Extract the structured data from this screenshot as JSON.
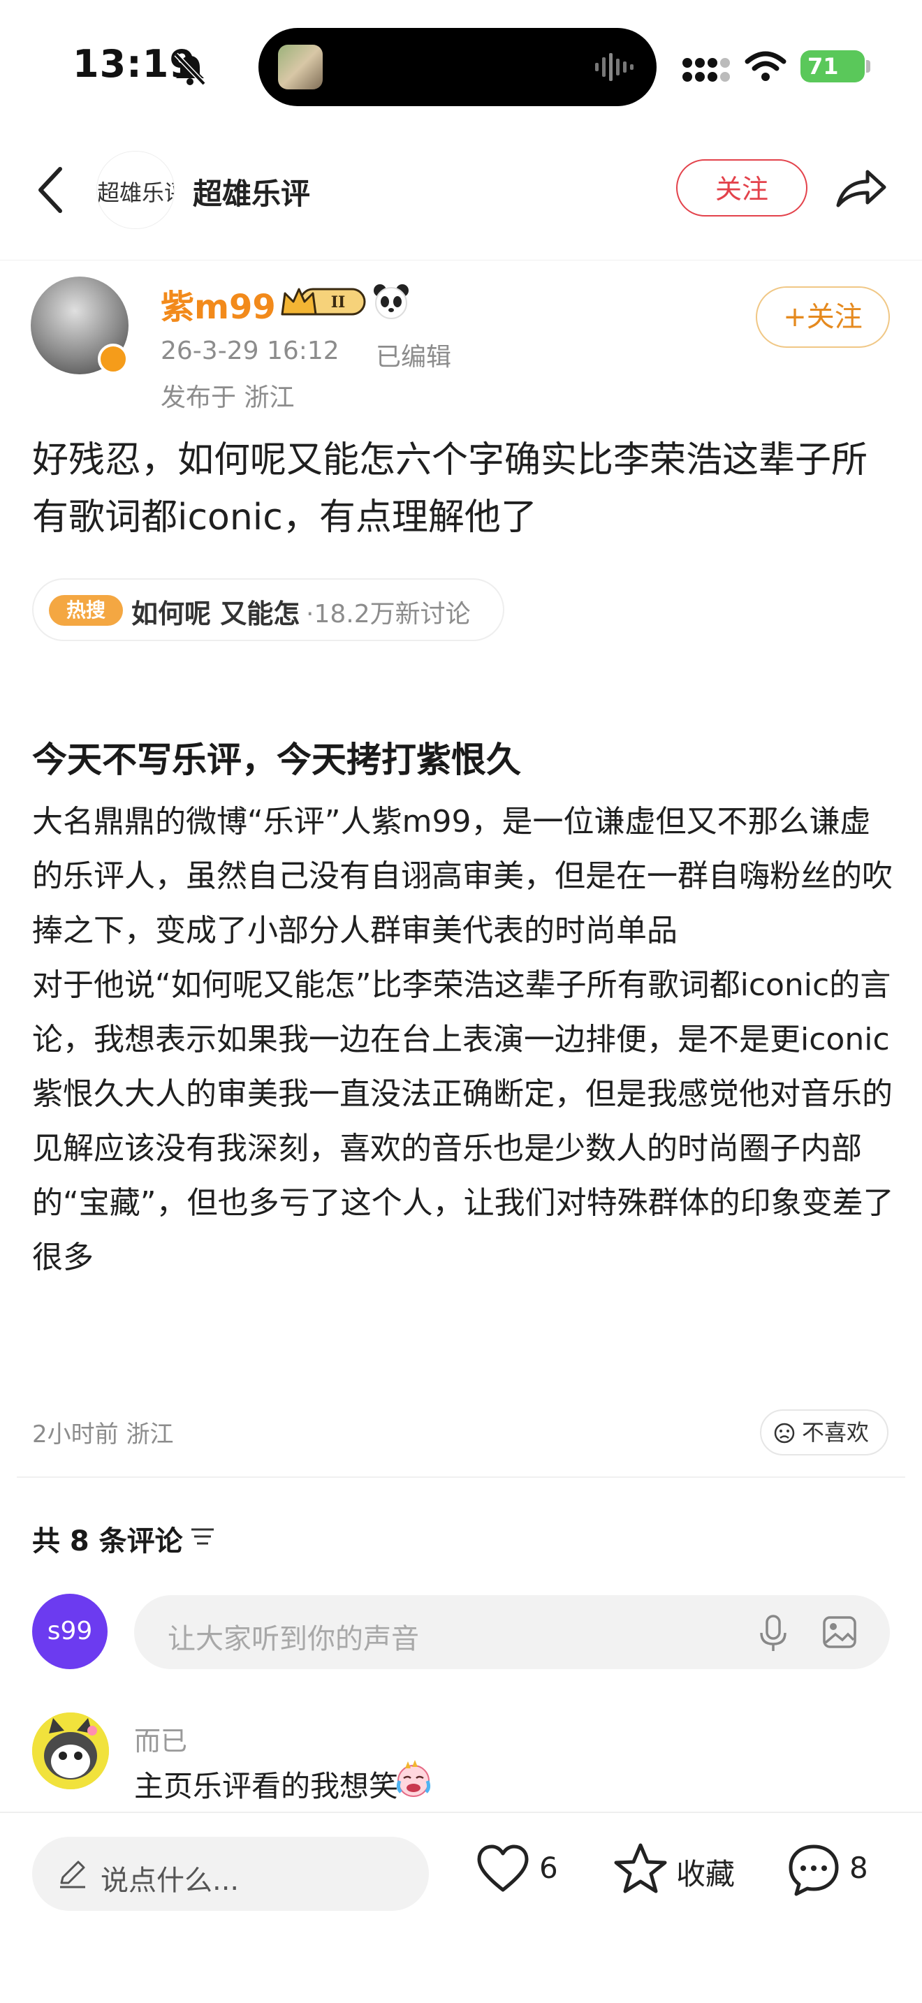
{
  "status_bar": {
    "time": "13:19",
    "battery": "71"
  },
  "nav": {
    "avatar_text": "超雄乐评",
    "title": "超雄乐评",
    "follow_label": "关注"
  },
  "post": {
    "author": "紫m99",
    "vip_level": "II",
    "time": "26-3-29 16:12",
    "edited": "已编辑",
    "location": "发布于 浙江",
    "follow_label": "+关注",
    "text": "好残忍，如何呢又能怎六个字确实比李荣浩这辈子所有歌词都iconic，有点理解他了",
    "hot": {
      "badge": "热搜",
      "topic": "如何呢 又能怎",
      "count": "·18.2万新讨论"
    }
  },
  "article": {
    "title": "今天不写乐评，今天拷打紫恨久",
    "paragraphs": [
      "大名鼎鼎的微博“乐评”人紫m99，是一位谦虚但又不那么谦虚的乐评人，虽然自己没有自诩高审美，但是在一群自嗨粉丝的吹捧之下，变成了小部分人群审美代表的时尚单品",
      "对于他说“如何呢又能怎”比李荣浩这辈子所有歌词都iconic的言论，我想表示如果我一边在台上表演一边排便，是不是更iconic",
      "紫恨久大人的审美我一直没法正确断定，但是我感觉他对音乐的见解应该没有我深刻，喜欢的音乐也是少数人的时尚圈子内部的“宝藏”，但也多亏了这个人，让我们对特殊群体的印象变差了很多"
    ],
    "meta": "2小时前 浙江",
    "dislike_label": "不喜欢"
  },
  "comments": {
    "header": "共 8 条评论",
    "my_avatar": "s99",
    "input_placeholder": "让大家听到你的声音",
    "items": [
      {
        "user": "而已",
        "text": "主页乐评看的我想笑"
      }
    ]
  },
  "bottom_bar": {
    "input_placeholder": "说点什么...",
    "like_count": "6",
    "favorite_label": "收藏",
    "comment_count": "8"
  },
  "colors": {
    "accent_red": "#e3424b",
    "accent_orange": "#f28a1b",
    "avatar_purple": "#6c3bf0"
  }
}
